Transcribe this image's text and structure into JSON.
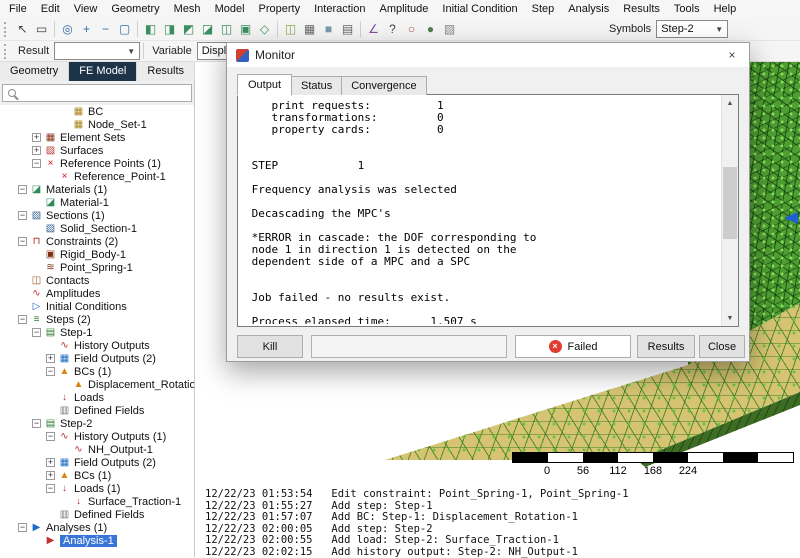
{
  "menu": {
    "items": [
      "File",
      "Edit",
      "View",
      "Geometry",
      "Mesh",
      "Model",
      "Property",
      "Interaction",
      "Amplitude",
      "Initial Condition",
      "Step",
      "Analysis",
      "Results",
      "Tools",
      "Help"
    ]
  },
  "toolbars": {
    "symbols_label": "Symbols",
    "symbols_value": "Step-2",
    "result_label": "Result",
    "result_value": "",
    "variable_label": "Variable",
    "variable_value": "Displacement",
    "icon_groups": [
      [
        {
          "name": "select-pointer-icon",
          "glyph": "↖",
          "color": "#444444"
        },
        {
          "name": "select-box-icon",
          "glyph": "▭",
          "color": "#444444"
        }
      ],
      [
        {
          "name": "zoom-fit-icon",
          "glyph": "◎",
          "color": "#2e6da4"
        },
        {
          "name": "zoom-in-icon",
          "glyph": "+",
          "color": "#2e6da4"
        },
        {
          "name": "zoom-out-icon",
          "glyph": "−",
          "color": "#2e6da4"
        },
        {
          "name": "zoom-window-icon",
          "glyph": "▢",
          "color": "#2e6da4"
        }
      ],
      [
        {
          "name": "view-front-icon",
          "glyph": "◧",
          "color": "#3a8f5f"
        },
        {
          "name": "view-back-icon",
          "glyph": "◨",
          "color": "#3a8f5f"
        },
        {
          "name": "view-top-icon",
          "glyph": "◩",
          "color": "#3a8f5f"
        },
        {
          "name": "view-bottom-icon",
          "glyph": "◪",
          "color": "#3a8f5f"
        },
        {
          "name": "view-left-icon",
          "glyph": "◫",
          "color": "#3a8f5f"
        },
        {
          "name": "view-right-icon",
          "glyph": "▣",
          "color": "#3a8f5f"
        },
        {
          "name": "view-iso-icon",
          "glyph": "◇",
          "color": "#3a8f5f"
        }
      ],
      [
        {
          "name": "section-view-icon",
          "glyph": "◫",
          "color": "#88aa44"
        },
        {
          "name": "wireframe-icon",
          "glyph": "▦",
          "color": "#666666"
        },
        {
          "name": "shaded-view-icon",
          "glyph": "■",
          "color": "#7a99aa"
        },
        {
          "name": "edges-icon",
          "glyph": "▤",
          "color": "#666666"
        }
      ],
      [
        {
          "name": "measure-icon",
          "glyph": "∠",
          "color": "#8a4a9a"
        },
        {
          "name": "query-icon",
          "glyph": "?",
          "color": "#444444"
        },
        {
          "name": "hide-icon",
          "glyph": "○",
          "color": "#b05050"
        },
        {
          "name": "show-icon",
          "glyph": "●",
          "color": "#508050"
        },
        {
          "name": "transparency-icon",
          "glyph": "▨",
          "color": "#888888"
        }
      ]
    ]
  },
  "panel": {
    "tabs": [
      {
        "label": "Geometry",
        "active": false
      },
      {
        "label": "FE Model",
        "active": true
      },
      {
        "label": "Results",
        "active": false
      }
    ],
    "search_value": ""
  },
  "tree": {
    "items": [
      {
        "label": "BC",
        "level": 4,
        "icon": "node-set-icon"
      },
      {
        "label": "Node_Set-1",
        "level": 4,
        "icon": "node-set-icon"
      },
      {
        "label": "Element Sets",
        "level": 2,
        "icon": "element-sets-icon",
        "expander": "plus"
      },
      {
        "label": "Surfaces",
        "level": 2,
        "icon": "surfaces-icon",
        "expander": "plus"
      },
      {
        "label": "Reference Points (1)",
        "level": 2,
        "icon": "reference-points-icon",
        "expander": "minus"
      },
      {
        "label": "Reference_Point-1",
        "level": 3,
        "icon": "reference-point-icon"
      },
      {
        "label": "Materials (1)",
        "level": 1,
        "icon": "materials-icon",
        "expander": "minus"
      },
      {
        "label": "Material-1",
        "level": 2,
        "icon": "material-icon"
      },
      {
        "label": "Sections (1)",
        "level": 1,
        "icon": "sections-icon",
        "expander": "minus"
      },
      {
        "label": "Solid_Section-1",
        "level": 2,
        "icon": "section-icon"
      },
      {
        "label": "Constraints (2)",
        "level": 1,
        "icon": "constraints-icon",
        "expander": "minus"
      },
      {
        "label": "Rigid_Body-1",
        "level": 2,
        "icon": "rigid-body-icon"
      },
      {
        "label": "Point_Spring-1",
        "level": 2,
        "icon": "point-spring-icon"
      },
      {
        "label": "Contacts",
        "level": 1,
        "icon": "contacts-icon"
      },
      {
        "label": "Amplitudes",
        "level": 1,
        "icon": "amplitudes-icon"
      },
      {
        "label": "Initial Conditions",
        "level": 1,
        "icon": "initial-conditions-icon"
      },
      {
        "label": "Steps (2)",
        "level": 1,
        "icon": "steps-icon",
        "expander": "minus"
      },
      {
        "label": "Step-1",
        "level": 2,
        "icon": "step-icon",
        "expander": "minus"
      },
      {
        "label": "History Outputs",
        "level": 3,
        "icon": "history-outputs-icon"
      },
      {
        "label": "Field Outputs (2)",
        "level": 3,
        "icon": "field-outputs-icon",
        "expander": "plus"
      },
      {
        "label": "BCs (1)",
        "level": 3,
        "icon": "bcs-icon",
        "expander": "minus"
      },
      {
        "label": "Displacement_Rotation-",
        "level": 4,
        "icon": "bc-icon"
      },
      {
        "label": "Loads",
        "level": 3,
        "icon": "loads-icon"
      },
      {
        "label": "Defined Fields",
        "level": 3,
        "icon": "defined-fields-icon"
      },
      {
        "label": "Step-2",
        "level": 2,
        "icon": "step-icon",
        "expander": "minus"
      },
      {
        "label": "History Outputs (1)",
        "level": 3,
        "icon": "history-outputs-icon",
        "expander": "minus"
      },
      {
        "label": "NH_Output-1",
        "level": 4,
        "icon": "history-output-icon"
      },
      {
        "label": "Field Outputs (2)",
        "level": 3,
        "icon": "field-outputs-icon",
        "expander": "plus"
      },
      {
        "label": "BCs (1)",
        "level": 3,
        "icon": "bcs-icon",
        "expander": "plus"
      },
      {
        "label": "Loads (1)",
        "level": 3,
        "icon": "loads-icon",
        "expander": "minus"
      },
      {
        "label": "Surface_Traction-1",
        "level": 4,
        "icon": "load-icon"
      },
      {
        "label": "Defined Fields",
        "level": 3,
        "icon": "defined-fields-icon"
      },
      {
        "label": "Analyses (1)",
        "level": 1,
        "icon": "analyses-icon",
        "expander": "minus"
      },
      {
        "label": "Analysis-1",
        "level": 2,
        "icon": "analysis-icon",
        "selected": true
      }
    ]
  },
  "monitor": {
    "title": "Monitor",
    "tabs": [
      {
        "label": "Output",
        "active": true
      },
      {
        "label": "Status",
        "active": false
      },
      {
        "label": "Convergence",
        "active": false
      }
    ],
    "output_text": "    print requests:          1\n    transformations:         0\n    property cards:          0\n\n\n STEP            1\n\n Frequency analysis was selected\n\n Decascading the MPC's\n\n *ERROR in cascade: the DOF corresponding to\n node 1 in direction 1 is detected on the\n dependent side of a MPC and a SPC\n\n\n Job failed - no results exist.\n\n Process elapsed time:      1.507 s",
    "buttons": {
      "kill": "Kill",
      "results": "Results",
      "close": "Close"
    },
    "status": "Failed"
  },
  "viewport": {
    "scale_bar": {
      "labels": [
        "0",
        "56",
        "112",
        "168",
        "224"
      ]
    }
  },
  "log": {
    "lines": [
      "12/22/23 01:53:54   Edit constraint: Point_Spring-1, Point_Spring-1",
      "12/22/23 01:55:27   Add step: Step-1",
      "12/22/23 01:57:07   Add BC: Step-1: Displacement_Rotation-1",
      "12/22/23 02:00:05   Add step: Step-2",
      "12/22/23 02:00:55   Add load: Step-2: Surface_Traction-1",
      "12/22/23 02:02:15   Add history output: Step-2: NH_Output-1"
    ]
  },
  "colors": {
    "selection": "#3875d7",
    "failed_red": "#e03c31",
    "mesh_green": "#4f9e33",
    "surface_tan": "#d6c472",
    "active_tab": "#1d3348"
  }
}
